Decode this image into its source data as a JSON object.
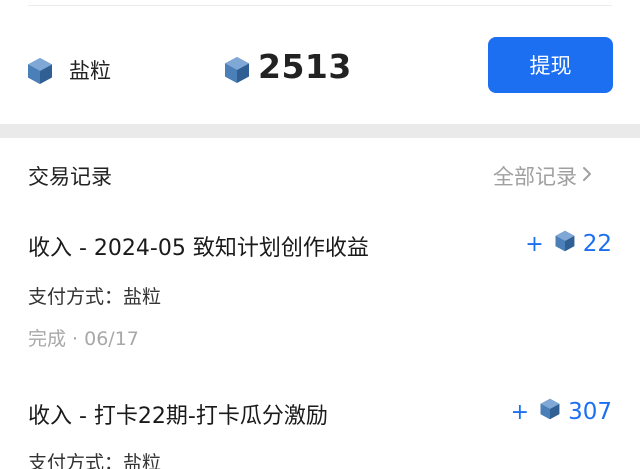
{
  "balance": {
    "label": "盐粒",
    "amount": "2513",
    "withdraw_label": "提现"
  },
  "records": {
    "title": "交易记录",
    "all_label": "全部记录"
  },
  "transactions": [
    {
      "title": "收入 - 2024-05 致知计划创作收益",
      "sign": "+",
      "amount": "22",
      "method": "支付方式：盐粒",
      "status": "完成 · 06/17"
    },
    {
      "title": "收入 - 打卡22期-打卡瓜分激励",
      "sign": "+",
      "amount": "307",
      "method": "支付方式：盐粒"
    }
  ],
  "colors": {
    "accent": "#1d6ff2",
    "gem_dark": "#2f5f93",
    "gem_light": "#7fa8d6"
  },
  "icons": {
    "currency": "salt-gem-icon",
    "chevron": "chevron-right-icon"
  }
}
